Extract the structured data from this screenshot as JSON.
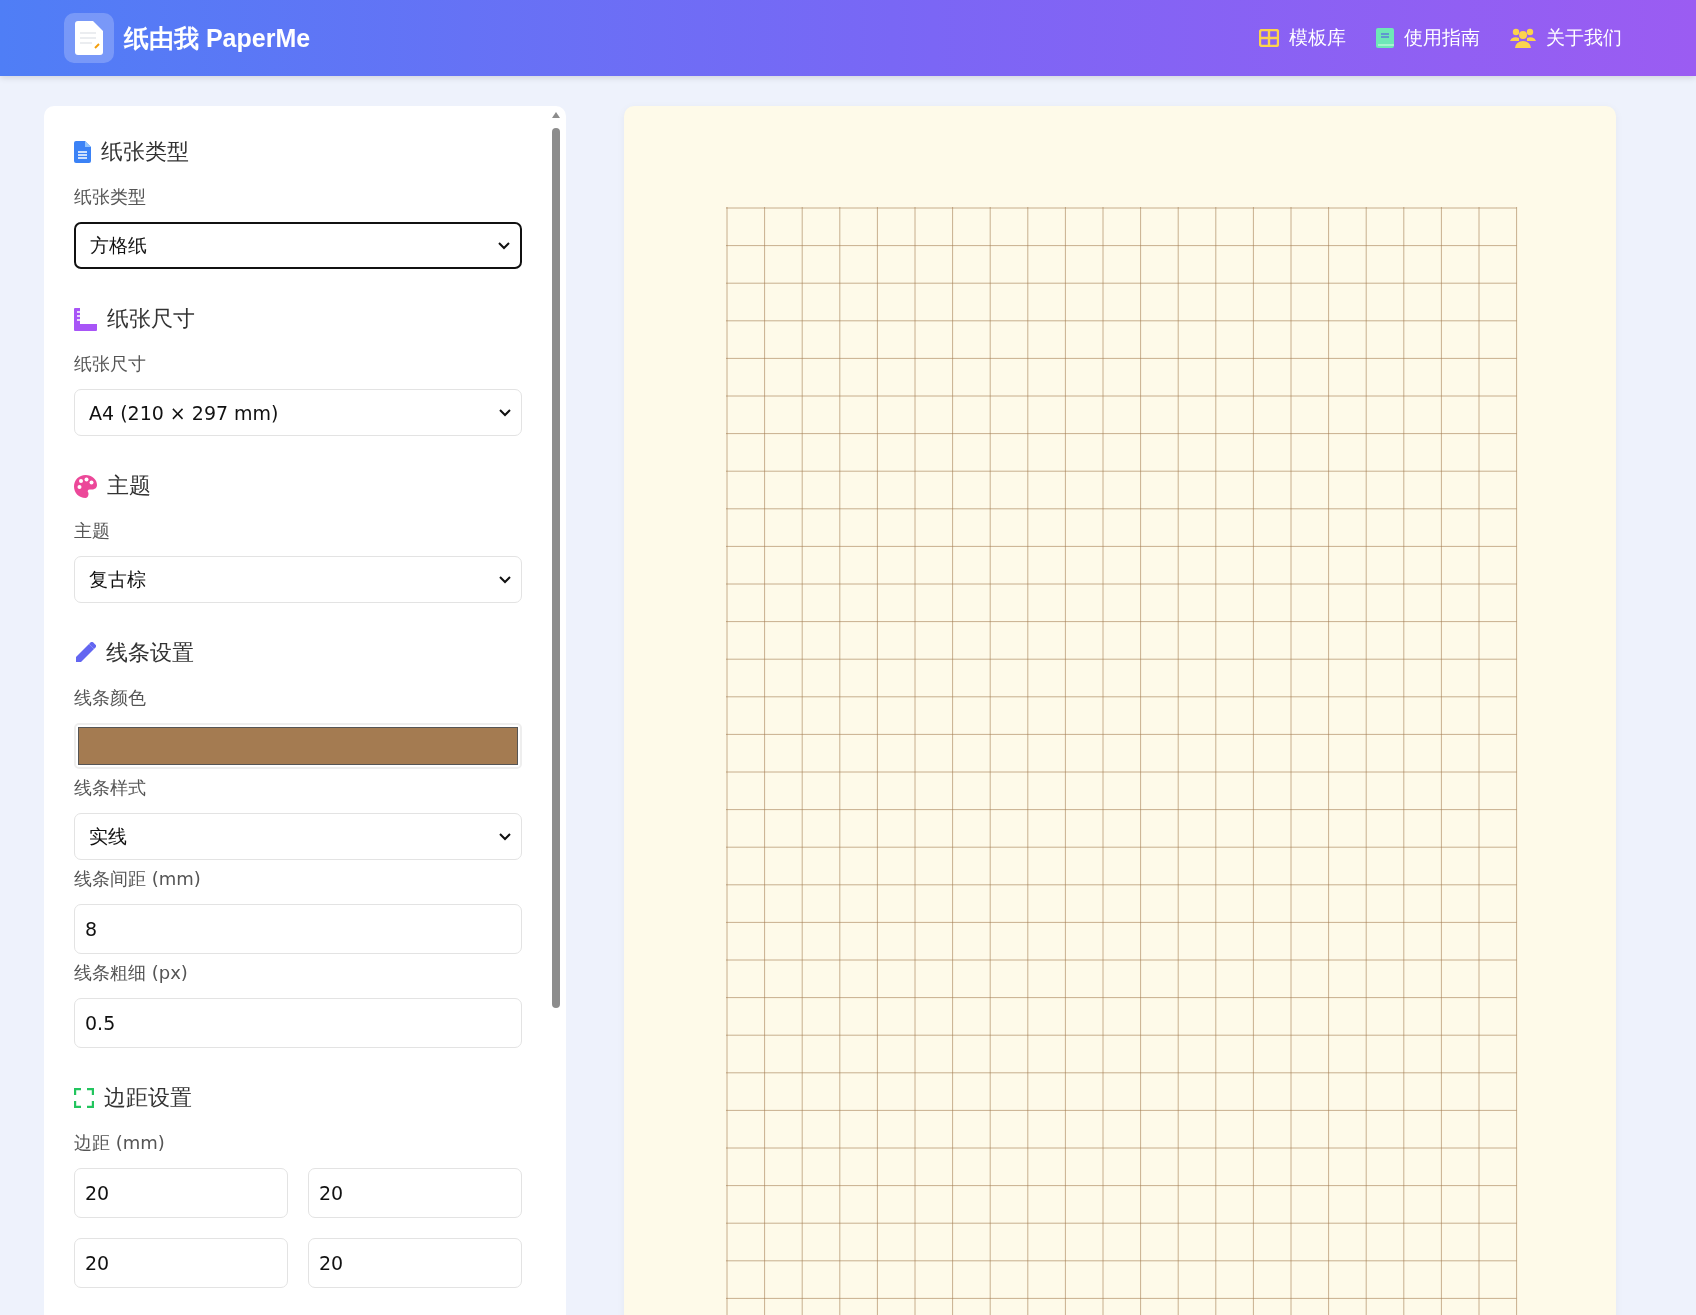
{
  "header": {
    "title": "纸由我 PaperMe",
    "nav": [
      {
        "label": "模板库"
      },
      {
        "label": "使用指南"
      },
      {
        "label": "关于我们"
      }
    ]
  },
  "sections": [
    {
      "title": "纸张类型",
      "fields": [
        {
          "kind": "select",
          "label": "纸张类型",
          "value": "方格纸",
          "focused": true
        }
      ]
    },
    {
      "title": "纸张尺寸",
      "fields": [
        {
          "kind": "select",
          "label": "纸张尺寸",
          "value": "A4 (210 × 297 mm)",
          "focused": false
        }
      ]
    },
    {
      "title": "主题",
      "fields": [
        {
          "kind": "select",
          "label": "主题",
          "value": "复古棕",
          "focused": false
        }
      ]
    },
    {
      "title": "线条设置",
      "fields": [
        {
          "kind": "color",
          "label": "线条颜色",
          "color": "#a47b51"
        },
        {
          "kind": "select",
          "label": "线条样式",
          "value": "实线",
          "focused": false
        },
        {
          "kind": "input",
          "label": "线条间距 (mm)",
          "value": "8"
        },
        {
          "kind": "input",
          "label": "线条粗细 (px)",
          "value": "0.5"
        }
      ]
    },
    {
      "title": "边距设置",
      "fields": [
        {
          "kind": "input_grid",
          "label": "边距 (mm)",
          "values": [
            "20",
            "20",
            "20",
            "20"
          ]
        }
      ]
    }
  ]
}
